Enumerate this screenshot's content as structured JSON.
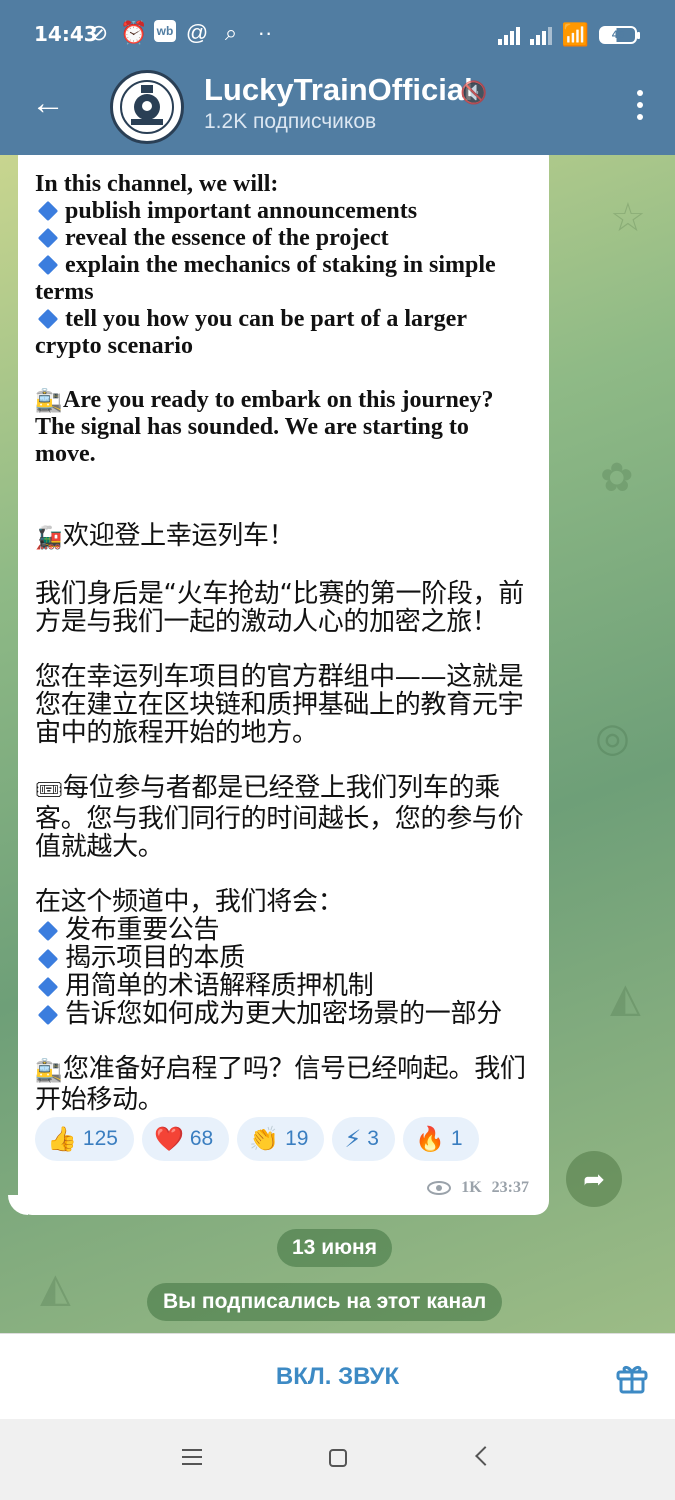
{
  "status_bar": {
    "time": "14:43",
    "left_icons": [
      "wifi-off-icon",
      "alarm-icon",
      "wb-app-icon",
      "at-icon",
      "search-icon",
      "more-dots-icon"
    ],
    "battery": "45"
  },
  "header": {
    "channel_name": "LuckyTrainOfficial",
    "subscribers": "1.2K подписчиков",
    "theme_color": "#517da2"
  },
  "message": {
    "english": {
      "intro": "In this channel, we will:",
      "bullets": [
        "publish important announcements",
        "reveal the essence of the project",
        "explain the mechanics of staking in simple terms",
        "tell you how you can be part of a larger crypto scenario"
      ],
      "closing_emoji": "🚉",
      "closing": "Are you ready to embark on this journey? The signal has sounded. We are starting to move."
    },
    "chinese": {
      "welcome_emoji": "🚂",
      "welcome": "欢迎登上幸运列车！",
      "p1": "我们身后是“火车抢劫“比赛的第一阶段，前方是与我们一起的激动人心的加密之旅！",
      "p2": "您在幸运列车项目的官方群组中——这就是您在建立在区块链和质押基础上的教育元宇宙中的旅程开始的地方。",
      "ticket_emoji": "🎟",
      "p3": "每位参与者都是已经登上我们列车的乘客。您与我们同行的时间越长，您的参与价值就越大。",
      "intro": "在这个频道中，我们将会：",
      "bullets": [
        "发布重要公告",
        "揭示项目的本质",
        "用简单的术语解释质押机制",
        "告诉您如何成为更大加密场景的一部分"
      ],
      "closing_emoji": "🚉",
      "closing": "您准备好启程了吗？信号已经响起。我们开始移动。"
    },
    "reactions": [
      {
        "emoji": "👍",
        "count": "125"
      },
      {
        "emoji": "❤️",
        "count": "68"
      },
      {
        "emoji": "👏",
        "count": "19"
      },
      {
        "emoji": "⚡",
        "count": "3"
      },
      {
        "emoji": "🔥",
        "count": "1"
      }
    ],
    "views": "1K",
    "time": "23:37"
  },
  "date_separator": "13 июня",
  "service_message": "Вы подписались на этот канал",
  "bottom": {
    "unmute_label": "ВКЛ. ЗВУК",
    "accent": "#3d8ac4"
  }
}
